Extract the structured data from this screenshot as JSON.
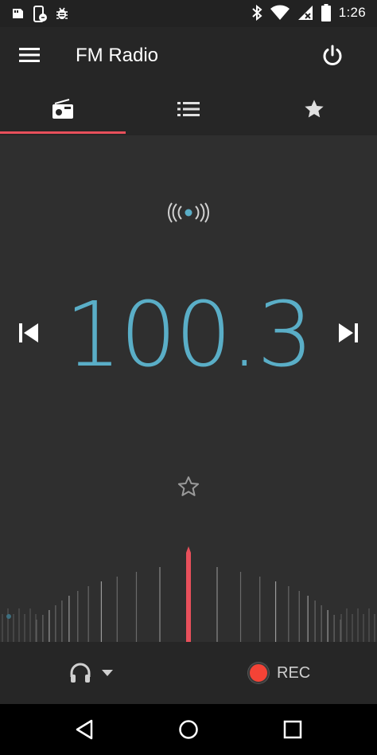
{
  "status_bar": {
    "time": "1:26",
    "left_icons": [
      "sd-card-icon",
      "phone-sync-icon",
      "bug-icon"
    ],
    "right_icons": [
      "bluetooth-icon",
      "wifi-icon",
      "signal-no-data-icon",
      "battery-icon"
    ]
  },
  "app_bar": {
    "title": "FM Radio",
    "menu_icon": "hamburger-menu-icon",
    "power_icon": "power-icon"
  },
  "tabs": [
    {
      "id": "radio",
      "icon": "radio-icon",
      "selected": true
    },
    {
      "id": "stations",
      "icon": "list-icon",
      "selected": false
    },
    {
      "id": "favorites",
      "icon": "star-icon",
      "selected": false
    }
  ],
  "player": {
    "frequency": "100.3",
    "signal_icon": "broadcast-signal-icon",
    "favorite": false
  },
  "tuner": {
    "min_mhz": 87.5,
    "max_mhz": 108.0,
    "current_mhz": 100.3
  },
  "bottom_bar": {
    "audio_route_icon": "headphones-icon",
    "rec_label": "REC"
  },
  "colors": {
    "accent": "#5aaec7",
    "indicator": "#e8505b",
    "record": "#f44336",
    "background": "#2f2f2f",
    "bar": "#262626"
  }
}
